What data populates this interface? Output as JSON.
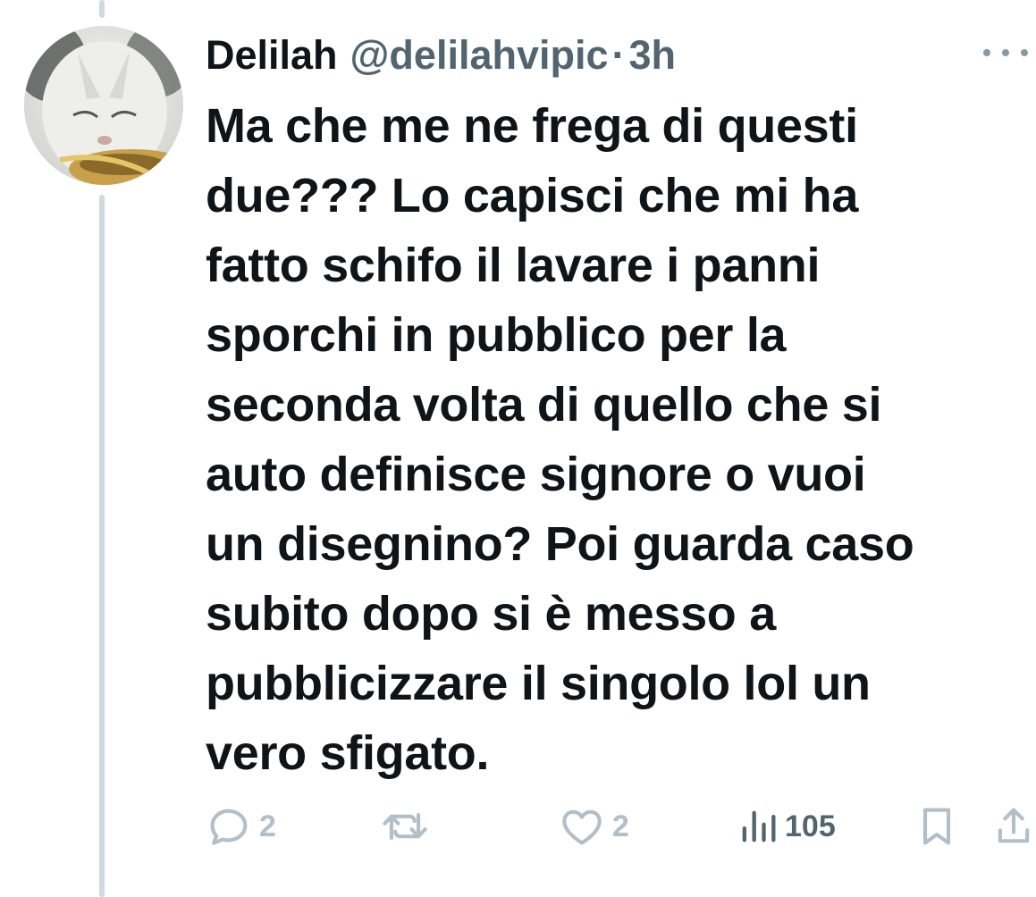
{
  "tweet": {
    "author": {
      "display_name": "Delilah",
      "handle": "@delilahvipic",
      "separator": "·",
      "time": "3h"
    },
    "text_lines": [
      "Ma che me ne frega di questi",
      "due??? Lo capisci che mi ha",
      "fatto schifo il lavare i panni",
      "sporchi in pubblico per la",
      "seconda volta di quello che si",
      "auto definisce signore o vuoi",
      "un disegnino? Poi guarda caso",
      "subito dopo si è messo a",
      "pubblicizzare il singolo lol un",
      "vero sfigato."
    ],
    "stats": {
      "replies": "2",
      "likes": "2",
      "views": "105"
    }
  },
  "icons": {
    "reply": "reply-icon",
    "retweet": "retweet-icon",
    "like": "heart-icon",
    "views": "views-icon",
    "bookmark": "bookmark-icon",
    "share": "share-icon",
    "more": "more-icon"
  },
  "colors": {
    "text": "#0f1419",
    "secondary": "#536471",
    "icon": "#8899a6",
    "thread_line": "#cfd9de"
  }
}
